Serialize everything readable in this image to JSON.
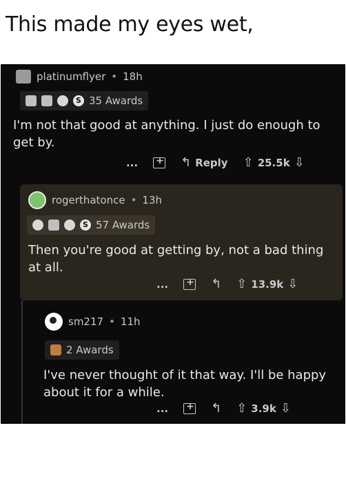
{
  "caption": "This made my eyes wet,",
  "comments": [
    {
      "username": "platinumflyer",
      "age": "18h",
      "awards": "35 Awards",
      "body": "I'm not that good at anything. I just do enough to get by.",
      "reply_label": "Reply",
      "score": "25.5k"
    },
    {
      "username": "rogerthatonce",
      "age": "13h",
      "awards": "57 Awards",
      "body": "Then you're good at getting by, not a bad thing at all.",
      "score": "13.9k"
    },
    {
      "username": "sm217",
      "age": "11h",
      "awards": "2 Awards",
      "body": "I've never thought of it that way. I'll be happy about it for a while.",
      "score": "3.9k"
    }
  ],
  "more_label": "...",
  "separator": "•"
}
